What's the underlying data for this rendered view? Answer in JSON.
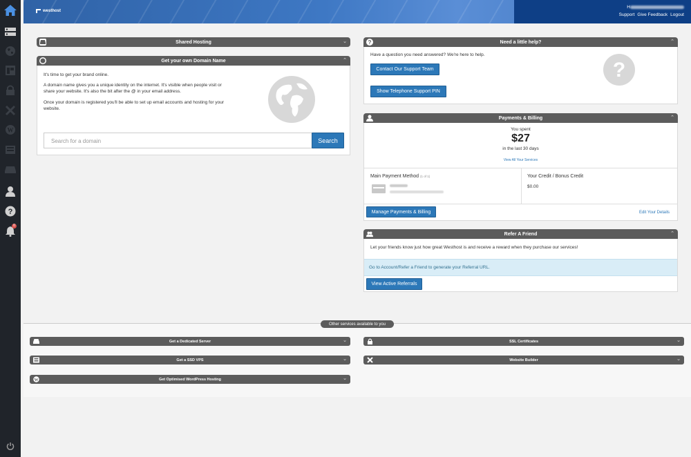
{
  "header": {
    "brand": "westhost",
    "user_email_prefix": "H",
    "links": [
      "Support",
      "Give Feedback",
      "Logout"
    ]
  },
  "nav": {
    "icons": [
      "home-icon",
      "hosting-icon",
      "globe-icon",
      "layout-icon",
      "lock-icon",
      "tools-icon",
      "wordpress-icon",
      "server-icon",
      "dedicated-server-icon",
      "user-icon",
      "help-icon",
      "bell-icon",
      "power-icon"
    ],
    "notification_count": "0"
  },
  "shared_hosting": {
    "title": "Shared Hosting"
  },
  "domain": {
    "title": "Get your own Domain Name",
    "intro": "It's time to get your brand online.",
    "para1": "A domain name gives you a unique identity on the internet. It's visible when people visit or share your website. It's also the bit after the @ in your email address.",
    "para2": "Once your domain is registered you'll be able to set up email accounts and hosting for your website.",
    "search_placeholder": "Search for a domain",
    "search_button": "Search"
  },
  "help": {
    "title": "Need a little help?",
    "text": "Have a question you need answered? We're here to help.",
    "contact_button": "Contact Our Support Team",
    "pin_button": "Show Telephone Support PIN"
  },
  "billing": {
    "title": "Payments & Billing",
    "you_spent": "You spent",
    "amount": "$27",
    "period": "in the last 30 days",
    "view_all": "View All Your Services",
    "main_payment_label": "Main Payment Method",
    "main_payment_count": "(1 of 1)",
    "credit_label": "Your Credit / Bonus Credit",
    "credit_value": "$0.00",
    "manage_button": "Manage Payments & Billing",
    "edit_link": "Edit Your Details"
  },
  "refer": {
    "title": "Refer A Friend",
    "text": "Let your friends know just how great Westhost is and receive a reward when they purchase our services!",
    "link_text": "Go to Account/Refer a Friend to generate your Referral URL.",
    "button": "View Active Referrals"
  },
  "services": {
    "pill": "Other services available to you",
    "items": [
      "Get a Dedicated Server",
      "SSL Certificates",
      "Get a SSD VPS",
      "Website Builder",
      "Get Optimised WordPress Hosting"
    ]
  }
}
